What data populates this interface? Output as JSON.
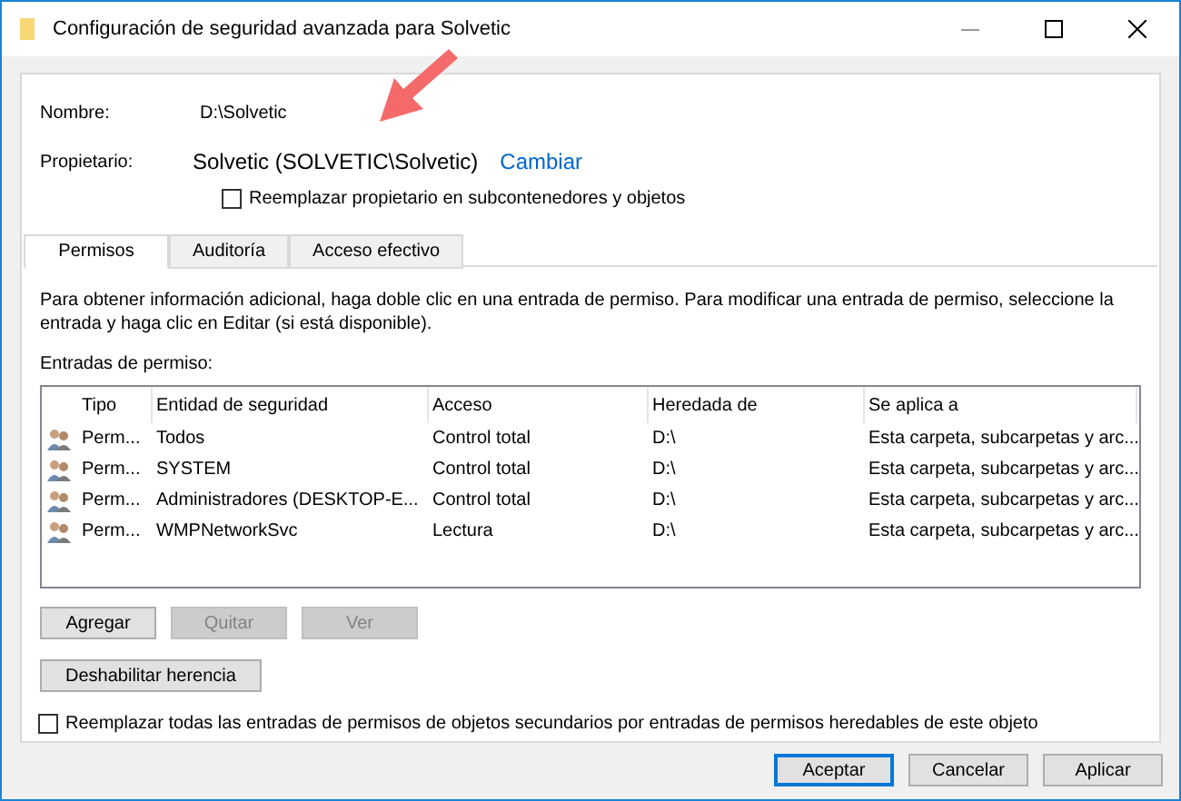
{
  "window": {
    "title": "Configuración de seguridad avanzada para Solvetic"
  },
  "name_label": "Nombre:",
  "name_value": "D:\\Solvetic",
  "owner_label": "Propietario:",
  "owner_value": "Solvetic (SOLVETIC\\Solvetic)",
  "owner_link": "Cambiar",
  "replace_owner": {
    "label": "Reemplazar propietario en subcontenedores y objetos",
    "checked": false
  },
  "tabs": [
    {
      "label": "Permisos",
      "selected": true
    },
    {
      "label": "Auditoría",
      "selected": false
    },
    {
      "label": "Acceso efectivo",
      "selected": false
    }
  ],
  "info": "Para obtener información adicional, haga doble clic en una entrada de permiso. Para modificar una entrada de permiso, seleccione la entrada y haga clic en Editar (si está disponible).",
  "entries_label": "Entradas de permiso:",
  "table": {
    "columns": [
      "Tipo",
      "Entidad de seguridad",
      "Acceso",
      "Heredada de",
      "Se aplica a"
    ],
    "rows": [
      [
        "Perm...",
        "Todos",
        "Control total",
        "D:\\",
        "Esta carpeta, subcarpetas y arc..."
      ],
      [
        "Perm...",
        "SYSTEM",
        "Control total",
        "D:\\",
        "Esta carpeta, subcarpetas y arc..."
      ],
      [
        "Perm...",
        "Administradores (DESKTOP-E...",
        "Control total",
        "D:\\",
        "Esta carpeta, subcarpetas y arc..."
      ],
      [
        "Perm...",
        "WMPNetworkSvc",
        "Lectura",
        "D:\\",
        "Esta carpeta, subcarpetas y arc..."
      ]
    ]
  },
  "entry_buttons": [
    {
      "label": "Agregar",
      "disabled": false
    },
    {
      "label": "Quitar",
      "disabled": true
    },
    {
      "label": "Ver",
      "disabled": true
    }
  ],
  "inheritance_button": "Deshabilitar herencia",
  "replace_children": {
    "label": "Reemplazar todas las entradas de permisos de objetos secundarios por entradas de permisos heredables de este objeto",
    "checked": false
  },
  "footer_buttons": [
    {
      "label": "Aceptar",
      "disabled": false
    },
    {
      "label": "Cancelar",
      "disabled": false
    },
    {
      "label": "Aplicar",
      "disabled": false
    }
  ]
}
